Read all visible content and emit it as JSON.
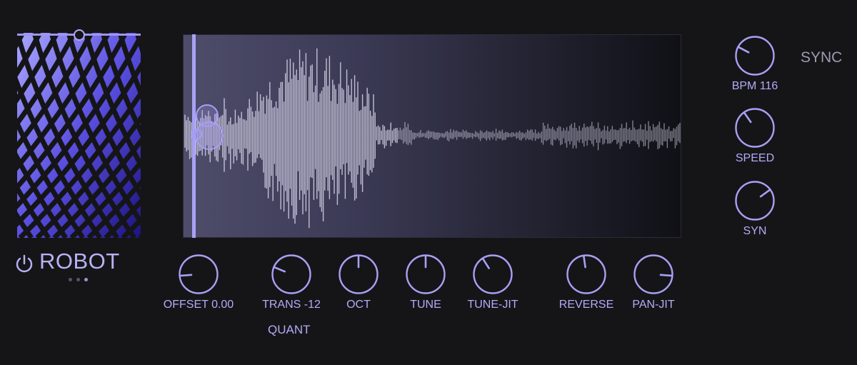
{
  "preset": {
    "name": "ROBOT",
    "power_icon": "power-icon",
    "page_dots": 3,
    "active_dot": 2
  },
  "art_slider": {
    "value": 0.5
  },
  "playhead": {
    "position": 0.02
  },
  "knobs_bottom": [
    {
      "id": "offset",
      "label": "OFFSET 0.00",
      "value": 0.15
    },
    {
      "id": "trans",
      "label": "TRANS -12",
      "value": 0.25
    },
    {
      "id": "oct",
      "label": "OCT",
      "value": 0.5
    },
    {
      "id": "tune",
      "label": "TUNE",
      "value": 0.5
    },
    {
      "id": "tune-jit",
      "label": "TUNE-JIT",
      "value": 0.38
    },
    {
      "id": "reverse",
      "label": "REVERSE",
      "value": 0.47
    },
    {
      "id": "pan-jit",
      "label": "PAN-JIT",
      "value": 0.85
    }
  ],
  "knobs_right": [
    {
      "id": "bpm",
      "label": "BPM 116",
      "value": 0.27
    },
    {
      "id": "speed",
      "label": "SPEED",
      "value": 0.37
    },
    {
      "id": "syn",
      "label": "SYN",
      "value": 0.7
    }
  ],
  "sync_label": "SYNC",
  "quant_label": "QUANT",
  "colors": {
    "accent": "#b3abf6",
    "background": "#151518",
    "knob_stroke": "#a9a0f4"
  }
}
